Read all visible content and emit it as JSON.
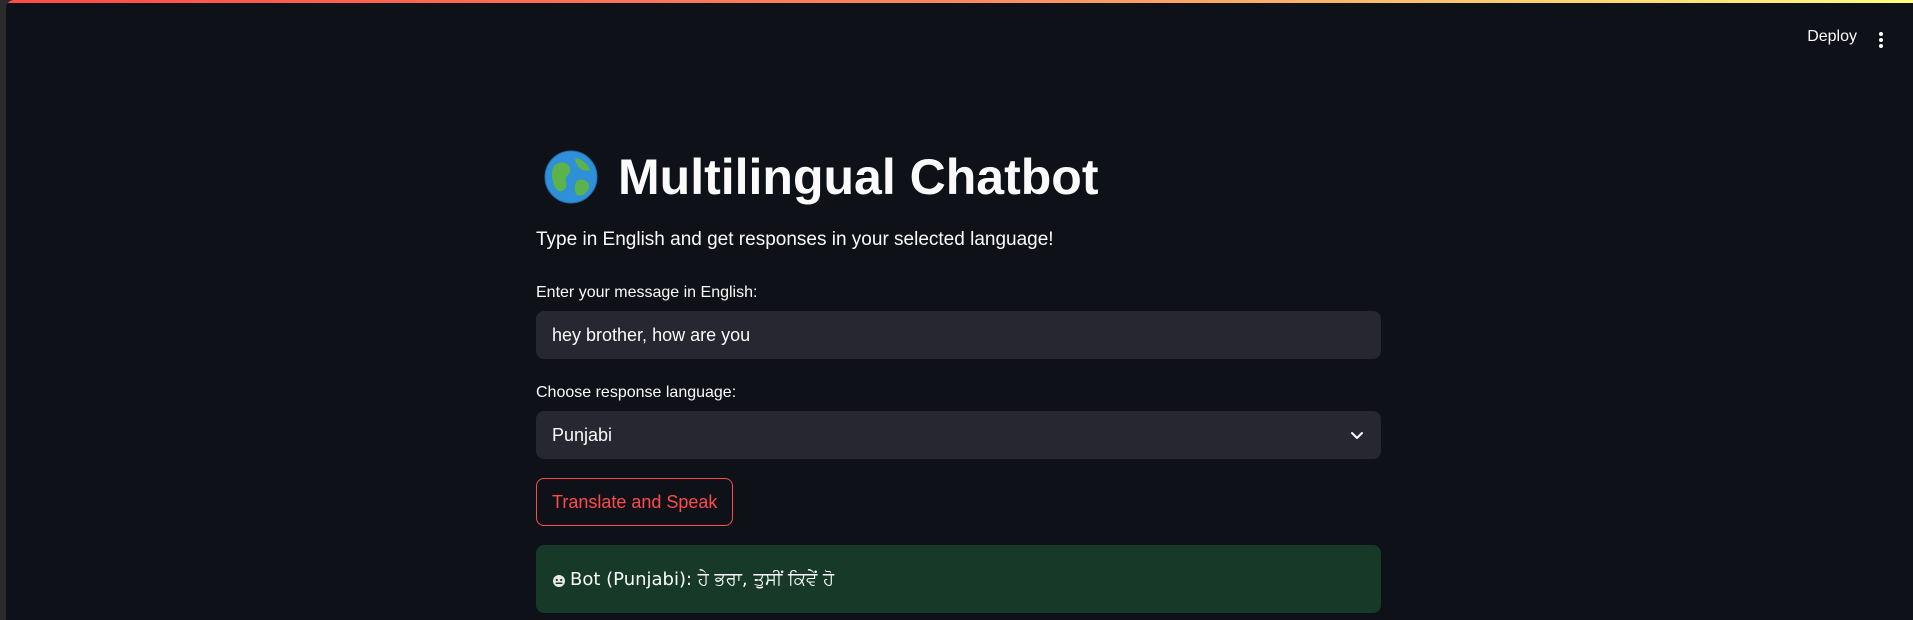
{
  "header": {
    "deploy_label": "Deploy",
    "menu_icon": "more-vertical-icon"
  },
  "accent": {
    "primary": "#ff4b4b",
    "success_bg": "#173928",
    "input_bg": "#262730",
    "app_bg": "#0e1117"
  },
  "main": {
    "title_icon": "globe-icon",
    "title": "Multilingual Chatbot",
    "subtitle": "Type in English and get responses in your selected language!",
    "message_label": "Enter your message in English:",
    "message_value": "hey brother, how are you",
    "language_label": "Choose response language:",
    "language_value": "Punjabi",
    "button_label": "Translate and Speak",
    "result_icon": "bot-icon",
    "result_text": "Bot (Punjabi): ਹੇ ਭਰਾ, ਤੁਸੀਂ ਕਿਵੇਂ ਹੋ"
  }
}
